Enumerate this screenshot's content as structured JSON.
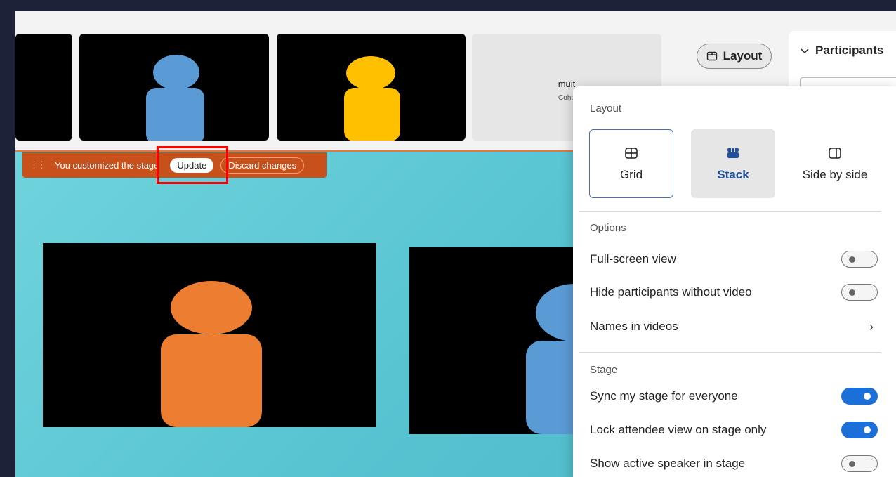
{
  "layout_button": {
    "label": "Layout",
    "icon": "layout-icon"
  },
  "participants_panel": {
    "title": "Participants",
    "icon": "chevron-down-icon"
  },
  "gallery": {
    "muted_tile": {
      "name": "muit",
      "subtitle": "Coho"
    }
  },
  "banner": {
    "message": "You customized the stage",
    "update_label": "Update",
    "discard_label": "Discard changes"
  },
  "flyout": {
    "layout_heading": "Layout",
    "layout_options": [
      {
        "label": "Grid",
        "icon": "grid-icon",
        "selected": false
      },
      {
        "label": "Stack",
        "icon": "stack-icon",
        "selected": true
      },
      {
        "label": "Side by side",
        "icon": "side-by-side-icon",
        "selected": false
      }
    ],
    "options_heading": "Options",
    "options": [
      {
        "label": "Full-screen view",
        "on": false
      },
      {
        "label": "Hide participants without video",
        "on": false
      },
      {
        "label": "Names in videos",
        "control": "chevron"
      }
    ],
    "stage_heading": "Stage",
    "stage": [
      {
        "label": "Sync my stage for everyone",
        "on": true
      },
      {
        "label": "Lock attendee view on stage only",
        "on": true
      },
      {
        "label": "Show active speaker in stage",
        "on": false
      }
    ]
  },
  "colors": {
    "accent_blue": "#1a6fd8",
    "banner_orange": "#c8501a",
    "highlight_red": "#ff0000",
    "avatar_blue": "#5b9bd5",
    "avatar_yellow": "#ffc000",
    "avatar_orange": "#ed7d31"
  }
}
